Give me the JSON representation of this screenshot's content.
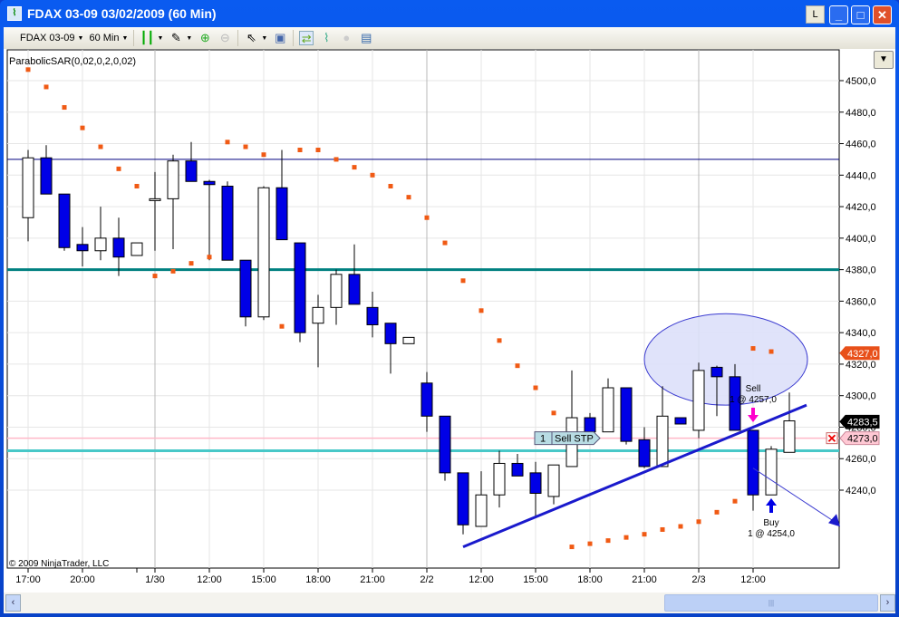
{
  "window": {
    "title": "FDAX 03-09  03/02/2009 (60 Min)",
    "l_button": "L",
    "minimize": "_",
    "maximize": "□",
    "close": "✕"
  },
  "toolbar": {
    "instrument": "FDAX 03-09",
    "interval": "60 Min",
    "icons": [
      "bar-style-icon",
      "drawing-pencil-icon",
      "zoom-in-icon",
      "zoom-out-icon",
      "cursor-icon",
      "data-box-icon",
      "chart-trader-icon",
      "strategy-icon",
      "disabled-icon",
      "properties-icon"
    ]
  },
  "indicator_label": "ParabolicSAR(0,02,0,2,0,02)",
  "copyright": "© 2009 NinjaTrader, LLC",
  "colors": {
    "down": "#0000e6",
    "up": "#ffffff",
    "sar": "#f05a14",
    "navy_line": "#000080",
    "teal_line": "#008080",
    "cyan_line": "#48c8c8",
    "pink_line": "#ffb8c8",
    "trend": "#1a1acc"
  },
  "chart_data": {
    "type": "candlestick",
    "ylim": [
      4190,
      4510
    ],
    "y_ticks": [
      "4500,0",
      "4480,0",
      "4460,0",
      "4440,0",
      "4420,0",
      "4400,0",
      "4380,0",
      "4360,0",
      "4340,0",
      "4320,0",
      "4300,0",
      "4280,0",
      "4260,0",
      "4240,0"
    ],
    "y_tick_values": [
      4500,
      4480,
      4460,
      4440,
      4420,
      4400,
      4380,
      4360,
      4340,
      4320,
      4300,
      4280,
      4260,
      4240
    ],
    "x_ticks": [
      {
        "bar": 0,
        "label": "17:00"
      },
      {
        "bar": 3,
        "label": "20:00"
      },
      {
        "bar": 7,
        "label": "1/30"
      },
      {
        "bar": 10,
        "label": "12:00"
      },
      {
        "bar": 13,
        "label": "15:00"
      },
      {
        "bar": 16,
        "label": "18:00"
      },
      {
        "bar": 19,
        "label": "21:00"
      },
      {
        "bar": 22,
        "label": "2/2"
      },
      {
        "bar": 25,
        "label": "12:00"
      },
      {
        "bar": 28,
        "label": "15:00"
      },
      {
        "bar": 31,
        "label": "18:00"
      },
      {
        "bar": 34,
        "label": "21:00"
      },
      {
        "bar": 37,
        "label": "2/3"
      },
      {
        "bar": 40,
        "label": "12:00"
      }
    ],
    "ohlc": [
      [
        4413,
        4456,
        4398,
        4451
      ],
      [
        4451,
        4459,
        4428,
        4428
      ],
      [
        4428,
        4428,
        4392,
        4394
      ],
      [
        4396,
        4407,
        4382,
        4392
      ],
      [
        4392,
        4420,
        4386,
        4400
      ],
      [
        4400,
        4413,
        4376,
        4388
      ],
      [
        4389,
        4397,
        4389,
        4397
      ],
      [
        4424,
        4442,
        4392,
        4425
      ],
      [
        4425,
        4453,
        4393,
        4449
      ],
      [
        4449,
        4461,
        4436,
        4436
      ],
      [
        4436,
        4437,
        4386,
        4434
      ],
      [
        4433,
        4436,
        4386,
        4386
      ],
      [
        4386,
        4386,
        4344,
        4350
      ],
      [
        4350,
        4433,
        4348,
        4432
      ],
      [
        4432,
        4456,
        4399,
        4399
      ],
      [
        4397,
        4397,
        4334,
        4340
      ],
      [
        4346,
        4364,
        4318,
        4356
      ],
      [
        4356,
        4380,
        4345,
        4377
      ],
      [
        4377,
        4396,
        4358,
        4358
      ],
      [
        4356,
        4366,
        4337,
        4345
      ],
      [
        4346,
        4346,
        4314,
        4333
      ],
      [
        4333,
        4337,
        4333,
        4337
      ],
      [
        4308,
        4315,
        4277,
        4287
      ],
      [
        4287,
        4287,
        4246,
        4251
      ],
      [
        4251,
        4251,
        4212,
        4218
      ],
      [
        4217,
        4252,
        4217,
        4237
      ],
      [
        4237,
        4265,
        4229,
        4257
      ],
      [
        4257,
        4263,
        4249,
        4249
      ],
      [
        4251,
        4258,
        4223,
        4238
      ],
      [
        4236,
        4256,
        4231,
        4256
      ],
      [
        4255,
        4316,
        4255,
        4286
      ],
      [
        4286,
        4289,
        4277,
        4277
      ],
      [
        4277,
        4311,
        4277,
        4305
      ],
      [
        4305,
        4305,
        4269,
        4271
      ],
      [
        4272,
        4280,
        4254,
        4255
      ],
      [
        4255,
        4306,
        4255,
        4287
      ],
      [
        4286,
        4286,
        4282,
        4282
      ],
      [
        4278,
        4321,
        4273,
        4316
      ],
      [
        4318,
        4319,
        4287,
        4312
      ],
      [
        4312,
        4320,
        4278,
        4278
      ],
      [
        4278,
        4278,
        4227,
        4237
      ],
      [
        4237,
        4268,
        4237,
        4266
      ],
      [
        4264,
        4302,
        4264,
        4284
      ]
    ],
    "sar": [
      4507,
      4496,
      4483,
      4470,
      4458,
      4444,
      4433,
      4376,
      4379,
      4384,
      4388,
      4461,
      4458,
      4453,
      4344,
      4456,
      4456,
      4450,
      4445,
      4440,
      4433,
      4426,
      4413,
      4397,
      4373,
      4354,
      4335,
      4319,
      4305,
      4289,
      4204,
      4206,
      4208,
      4210,
      4212,
      4215,
      4217,
      4220,
      4226,
      4233,
      4330,
      4328
    ],
    "hlines": [
      {
        "price": 4450,
        "color": "#000080"
      },
      {
        "price": 4380,
        "color": "#008080"
      },
      {
        "price": 4265,
        "color": "#48c8c8"
      },
      {
        "price": 4273,
        "color": "#ffb8c8"
      }
    ],
    "trendline": {
      "from": [
        24,
        4204
      ],
      "to": [
        42.95,
        4294
      ]
    },
    "ray": {
      "from": [
        40,
        4254
      ],
      "to": [
        44.75,
        4218
      ]
    },
    "ellipse": {
      "center": [
        38.5,
        4323
      ],
      "rx_bars": 4.5,
      "ry_price": 29
    },
    "price_markers": [
      {
        "label": "4327,0",
        "price": 4327,
        "bg": "#e8501a",
        "fg": "#ffffff"
      },
      {
        "label": "4283,5",
        "price": 4283.5,
        "bg": "#000000",
        "fg": "#ffffff"
      },
      {
        "label": "4273,0",
        "price": 4273,
        "bg": "#ffc8d4",
        "fg": "#000000"
      }
    ],
    "order": {
      "qty": "1",
      "label": "Sell STP",
      "price": 4273
    },
    "executions": [
      {
        "side": "Sell",
        "text": "1 @ 4257,0",
        "bar": 40
      },
      {
        "side": "Buy",
        "text": "1 @ 4254,0",
        "bar": 41
      }
    ]
  }
}
